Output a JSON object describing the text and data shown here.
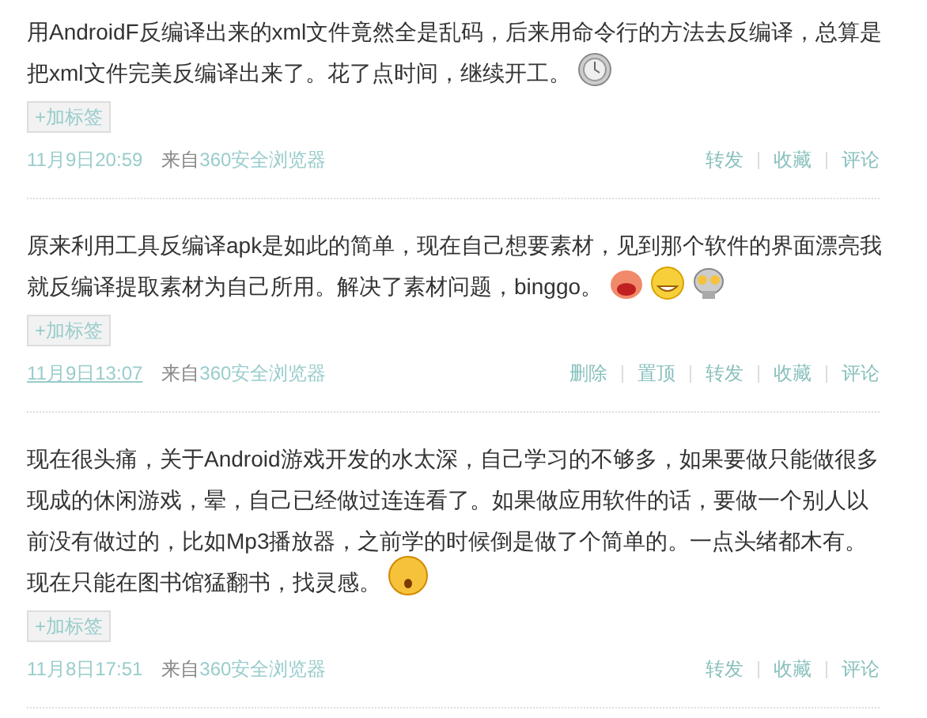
{
  "posts": [
    {
      "text": "用AndroidF反编译出来的xml文件竟然全是乱码，后来用命令行的方法去反编译，总算是把xml文件完美反编译出来了。花了点时间，继续开工。",
      "emoticons": [
        {
          "kind": "clock"
        }
      ],
      "tag_button": "+加标签",
      "time": {
        "label": "11月9日20:59",
        "hover": false
      },
      "source_prefix": "来自",
      "source": "360安全浏览器",
      "actions": [
        "转发",
        "收藏",
        "评论"
      ]
    },
    {
      "text": "原来利用工具反编译apk是如此的简单，现在自己想要素材，见到那个软件的界面漂亮我就反编译提取素材为自己所用。解决了素材问题，binggo。",
      "emoticons": [
        {
          "kind": "laugh"
        },
        {
          "kind": "grin"
        },
        {
          "kind": "robot"
        }
      ],
      "tag_button": "+加标签",
      "time": {
        "label": "11月9日13:07",
        "hover": true
      },
      "source_prefix": "来自",
      "source": "360安全浏览器",
      "actions": [
        "删除",
        "置顶",
        "转发",
        "收藏",
        "评论"
      ]
    },
    {
      "text": "现在很头痛，关于Android游戏开发的水太深，自己学习的不够多，如果要做只能做很多现成的休闲游戏，晕，自己已经做过连连看了。如果做应用软件的话，要做一个别人以前没有做过的，比如Mp3播放器，之前学的时候倒是做了个简单的。一点头绪都木有。现在只能在图书馆猛翻书，找灵感。",
      "emoticons": [
        {
          "kind": "surprised"
        }
      ],
      "tag_button": "+加标签",
      "time": {
        "label": "11月8日17:51",
        "hover": false
      },
      "source_prefix": "来自",
      "source": "360安全浏览器",
      "actions": [
        "转发",
        "收藏",
        "评论"
      ]
    }
  ]
}
